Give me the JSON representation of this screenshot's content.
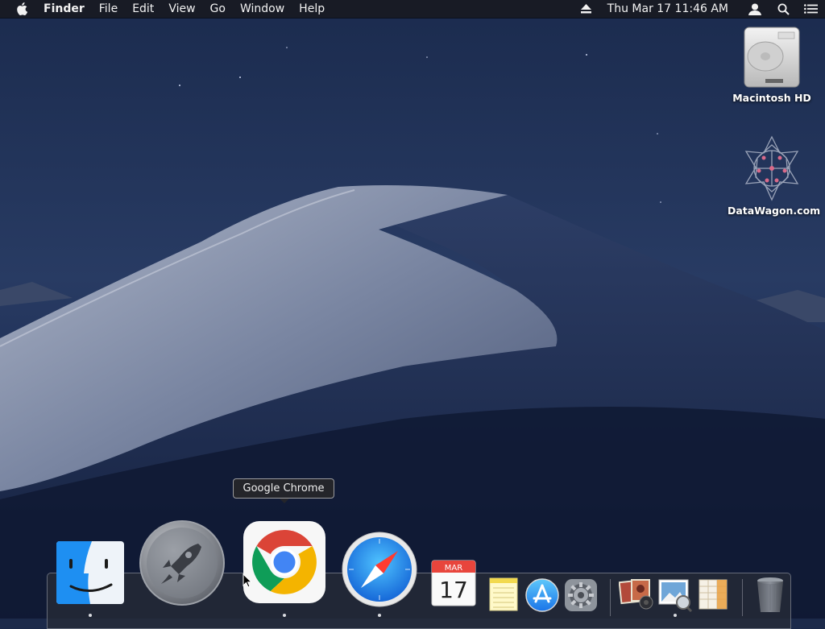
{
  "menubar": {
    "apple_icon": "apple-logo-icon",
    "app_name": "Finder",
    "menus": [
      "File",
      "Edit",
      "View",
      "Go",
      "Window",
      "Help"
    ],
    "status_icons": [
      "eject-icon",
      "user-icon",
      "spotlight-search-icon",
      "notification-list-icon"
    ],
    "clock": "Thu Mar 17  11:46 AM"
  },
  "desktop": {
    "icons": [
      {
        "label": "Macintosh HD",
        "icon": "hard-drive-icon"
      },
      {
        "label": "DataWagon.com",
        "icon": "datawagon-logo-icon"
      }
    ]
  },
  "tooltip": {
    "text": "Google Chrome"
  },
  "dock": {
    "items": [
      {
        "app": "finder-icon"
      },
      {
        "app": "launchpad-icon"
      },
      {
        "app": "google-chrome-icon"
      },
      {
        "app": "safari-icon"
      },
      {
        "app": "calendar-icon",
        "month": "MAR",
        "day": "17"
      },
      {
        "app": "notes-icon"
      },
      {
        "app": "app-store-icon"
      },
      {
        "app": "system-preferences-icon"
      },
      {
        "app": "photo-booth-icon"
      },
      {
        "app": "preview-icon"
      },
      {
        "app": "ical-icon"
      },
      {
        "app": "trash-icon"
      }
    ]
  },
  "colors": {
    "chrome_red": "#db4437",
    "chrome_green": "#0f9d58",
    "chrome_yellow": "#f4b400",
    "chrome_blue": "#4285f4",
    "finder_blue": "#1e8ff2"
  }
}
